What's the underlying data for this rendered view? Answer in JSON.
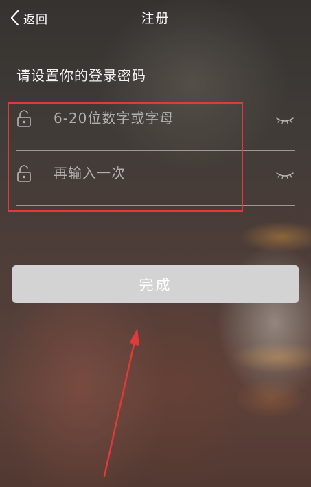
{
  "navbar": {
    "back_label": "返回",
    "title": "注册"
  },
  "form": {
    "section_label": "请设置你的登录密码",
    "password": {
      "placeholder": "6-20位数字或字母",
      "value": ""
    },
    "confirm": {
      "placeholder": "再输入一次",
      "value": ""
    }
  },
  "submit_label": "完成",
  "icons": {
    "back": "chevron-left-icon",
    "lock": "lock-icon",
    "eye": "eye-closed-icon"
  },
  "colors": {
    "annotation": "#e03a3a",
    "button_bg": "#d3d3d3",
    "text": "#ffffff"
  }
}
